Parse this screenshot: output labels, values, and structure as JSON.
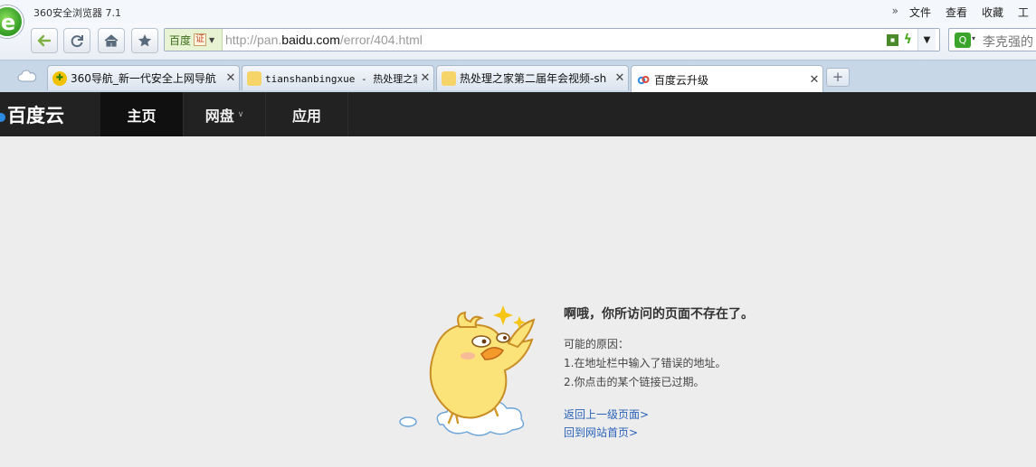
{
  "window": {
    "title": "360安全浏览器 7.1",
    "menu": [
      "文件",
      "查看",
      "收藏",
      "工"
    ]
  },
  "navbar": {
    "site_name": "百度",
    "cert_badge": "证",
    "url_prefix": "http://pan.",
    "url_domain": "baidu.com",
    "url_path": "/error/404.html",
    "search_text": "李克强的"
  },
  "tabs": [
    {
      "label": "360导航_新一代安全上网导航",
      "icon": "shield-plus-icon",
      "active": false
    },
    {
      "label": "tianshanbingxue - 热处理之家",
      "icon": "chat-bubble-icon",
      "active": false
    },
    {
      "label": "热处理之家第二届年会视频-sh",
      "icon": "chat-bubble-icon",
      "active": false
    },
    {
      "label": "百度云升级",
      "icon": "baidu-cloud-icon",
      "active": true
    }
  ],
  "site": {
    "logo_text": "百度云",
    "nav": [
      {
        "label": "主页",
        "active": true
      },
      {
        "label": "网盘",
        "active": false,
        "has_dropdown": true
      },
      {
        "label": "应用",
        "active": false
      }
    ]
  },
  "error": {
    "title": "啊哦，你所访问的页面不存在了。",
    "reasons_heading": "可能的原因：",
    "reasons": [
      "1.在地址栏中输入了错误的地址。",
      "2.你点击的某个链接已过期。"
    ],
    "links": [
      "返回上一级页面>",
      "回到网站首页>"
    ]
  },
  "colors": {
    "site_header_bg": "#222222",
    "page_bg": "#ededee",
    "link": "#2a62b8",
    "tabbar_bg": "#c8d7e8"
  }
}
